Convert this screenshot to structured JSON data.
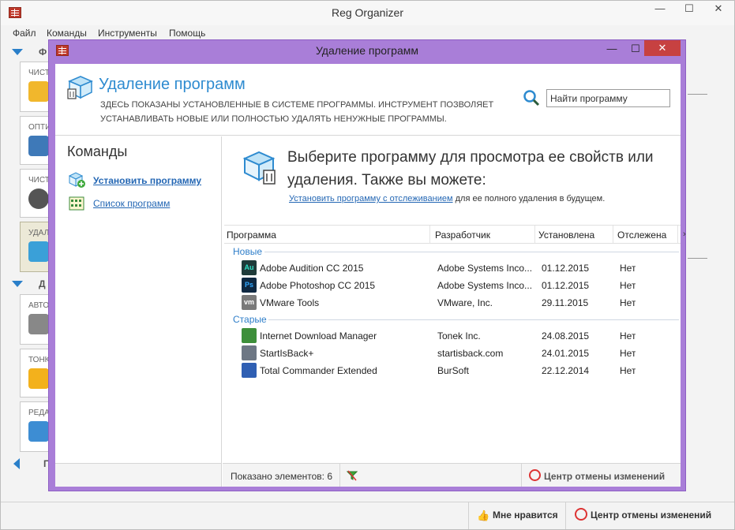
{
  "main_window": {
    "title": "Reg Organizer",
    "controls": {
      "minimize": "—",
      "maximize": "☐",
      "close": "✕"
    },
    "menu": [
      "Файл",
      "Команды",
      "Инструменты",
      "Помощь"
    ],
    "sidebar": {
      "section1_initial": "Ф",
      "section2_initial": "Д",
      "section3_initial": "П",
      "tools": [
        "ЧИСТ",
        "ОПТИ",
        "ЧИСТ",
        "УДАЛ",
        "АВТО",
        "ТОНК",
        "РЕДА"
      ]
    },
    "status": {
      "like_label": "Мне нравится",
      "undo_center_label": "Центр отмены изменений"
    }
  },
  "dialog": {
    "title": "Удаление программ",
    "close": "✕",
    "minimize": "—",
    "maximize": "☐",
    "header": {
      "title": "Удаление программ",
      "description": "ЗДЕСЬ ПОКАЗАНЫ УСТАНОВЛЕННЫЕ В СИСТЕМЕ ПРОГРАММЫ. ИНСТРУМЕНТ ПОЗВОЛЯЕТ УСТАНАВЛИВАТЬ НОВЫЕ ИЛИ ПОЛНОСТЬЮ УДАЛЯТЬ НЕНУЖНЫЕ ПРОГРАММЫ.",
      "search_value": "Найти программу"
    },
    "commands": {
      "title": "Команды",
      "install_label": "Установить программу",
      "list_label": "Список программ"
    },
    "info": {
      "text": "Выберите программу для просмотра ее свойств или удаления. Также вы можете:",
      "link": "Установить программу с отслеживанием",
      "suffix": " для ее полного удаления в будущем."
    },
    "columns": [
      "Программа",
      "Разработчик",
      "Установлена",
      "Отслежена"
    ],
    "groups": [
      {
        "label": "Новые",
        "rows": [
          {
            "name": "Adobe Audition CC 2015",
            "developer": "Adobe Systems Inco...",
            "installed": "01.12.2015",
            "tracked": "Нет",
            "icon": "audition-icon",
            "icon_text": "Au",
            "icon_bg": "#1f3b3a",
            "icon_fg": "#2fe0c5"
          },
          {
            "name": "Adobe Photoshop CC 2015",
            "developer": "Adobe Systems Inco...",
            "installed": "01.12.2015",
            "tracked": "Нет",
            "icon": "photoshop-icon",
            "icon_text": "Ps",
            "icon_bg": "#0f2841",
            "icon_fg": "#31a8ff"
          },
          {
            "name": "VMware Tools",
            "developer": "VMware, Inc.",
            "installed": "29.11.2015",
            "tracked": "Нет",
            "icon": "vmware-icon",
            "icon_text": "vm",
            "icon_bg": "#7a7a7a",
            "icon_fg": "#ffffff"
          }
        ]
      },
      {
        "label": "Старые",
        "rows": [
          {
            "name": "Internet Download Manager",
            "developer": "Tonek Inc.",
            "installed": "24.08.2015",
            "tracked": "Нет",
            "icon": "idm-icon",
            "icon_text": "",
            "icon_bg": "#3d8f3a",
            "icon_fg": "#ffffff"
          },
          {
            "name": "StartIsBack+",
            "developer": "startisback.com",
            "installed": "24.01.2015",
            "tracked": "Нет",
            "icon": "startisback-icon",
            "icon_text": "",
            "icon_bg": "#6d7784",
            "icon_fg": "#ffffff"
          },
          {
            "name": "Total Commander Extended",
            "developer": "BurSoft",
            "installed": "22.12.2014",
            "tracked": "Нет",
            "icon": "total-commander-icon",
            "icon_text": "",
            "icon_bg": "#2f5fb3",
            "icon_fg": "#ffffff"
          }
        ]
      }
    ],
    "status": {
      "shown": "Показано элементов: 6",
      "undo_center": "Центр отмены изменений"
    }
  },
  "colors": {
    "accent": "#2e8bd0",
    "dialog_frame": "#a97ed8",
    "link": "#2467b4",
    "close_red": "#c74141"
  }
}
